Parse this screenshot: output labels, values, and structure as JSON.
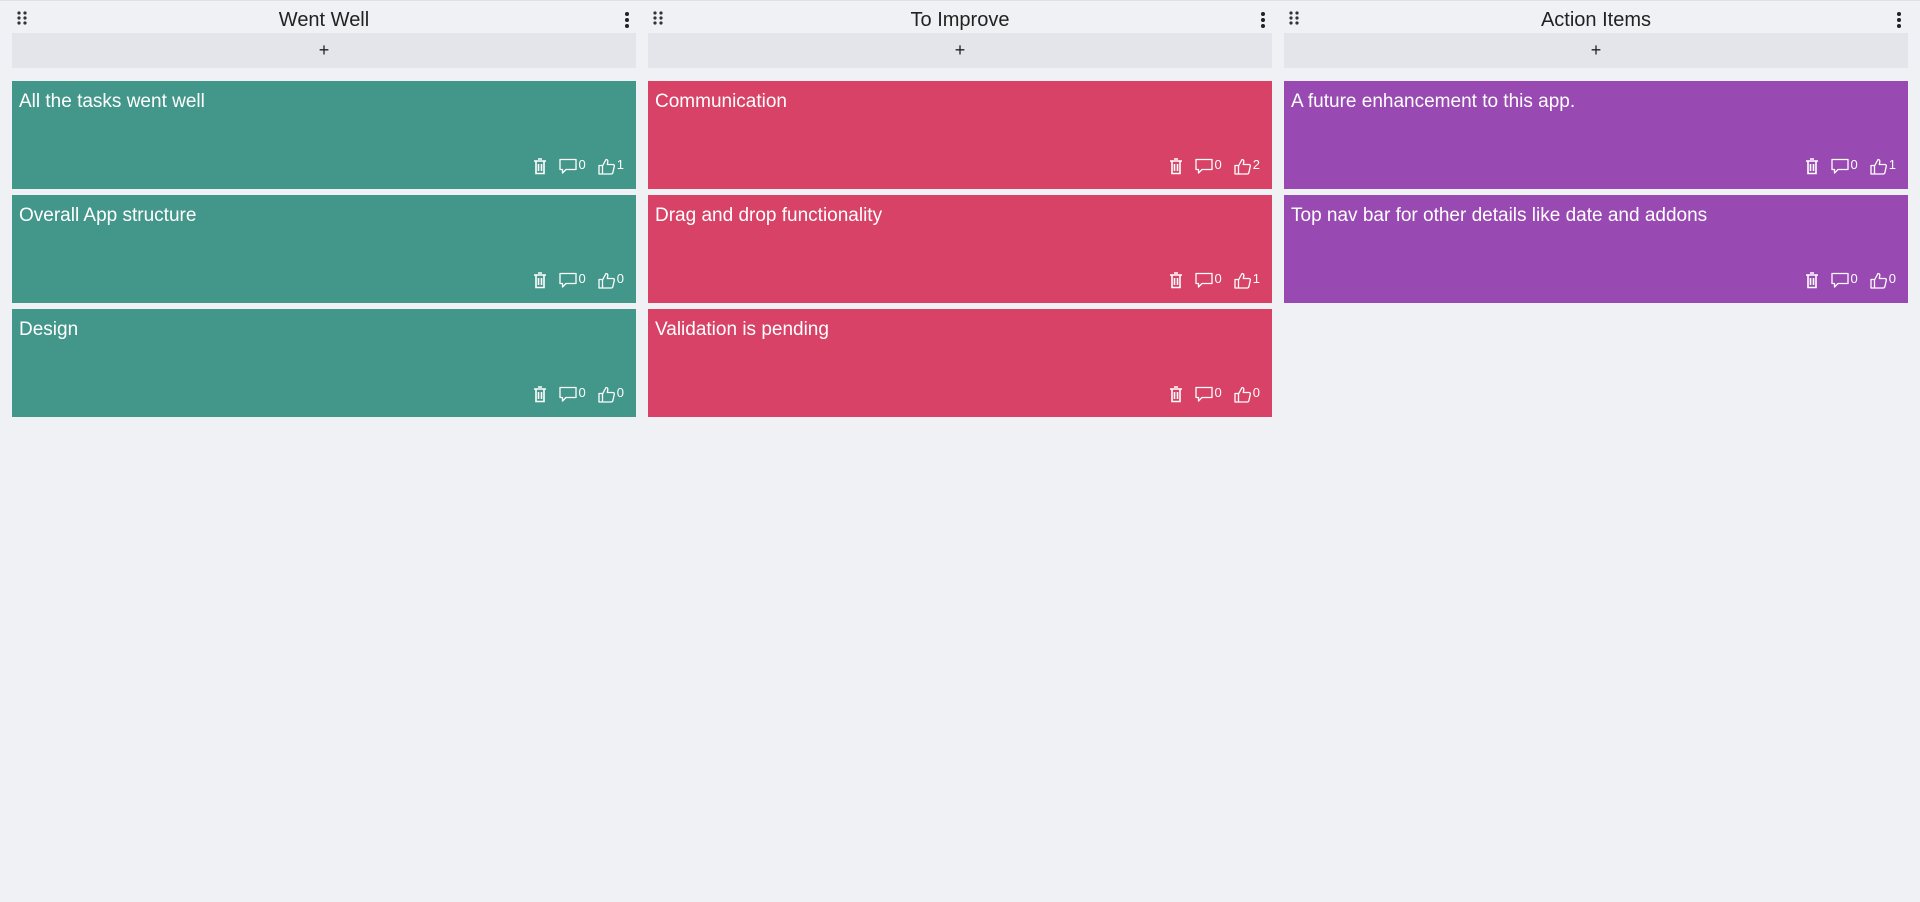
{
  "board": {
    "columns": [
      {
        "title": "Went Well",
        "add_label": "+",
        "color": "#43978a",
        "cards": [
          {
            "text": "All the tasks went well",
            "comments": "0",
            "likes": "1"
          },
          {
            "text": "Overall App structure",
            "comments": "0",
            "likes": "0"
          },
          {
            "text": "Design",
            "comments": "0",
            "likes": "0"
          }
        ]
      },
      {
        "title": "To Improve",
        "add_label": "+",
        "color": "#d84266",
        "cards": [
          {
            "text": "Communication",
            "comments": "0",
            "likes": "2"
          },
          {
            "text": "Drag and drop functionality",
            "comments": "0",
            "likes": "1"
          },
          {
            "text": "Validation is pending",
            "comments": "0",
            "likes": "0"
          }
        ]
      },
      {
        "title": "Action Items",
        "add_label": "+",
        "color": "#9949b2",
        "cards": [
          {
            "text": "A future enhancement to this app.",
            "comments": "0",
            "likes": "1"
          },
          {
            "text": "Top nav bar for other details like date and addons",
            "comments": "0",
            "likes": "0"
          }
        ]
      }
    ],
    "icons": {
      "drag": "drag-handle-icon",
      "menu": "kebab-menu-icon",
      "delete": "trash-icon",
      "comment": "comment-icon",
      "like": "thumbs-up-icon"
    }
  }
}
